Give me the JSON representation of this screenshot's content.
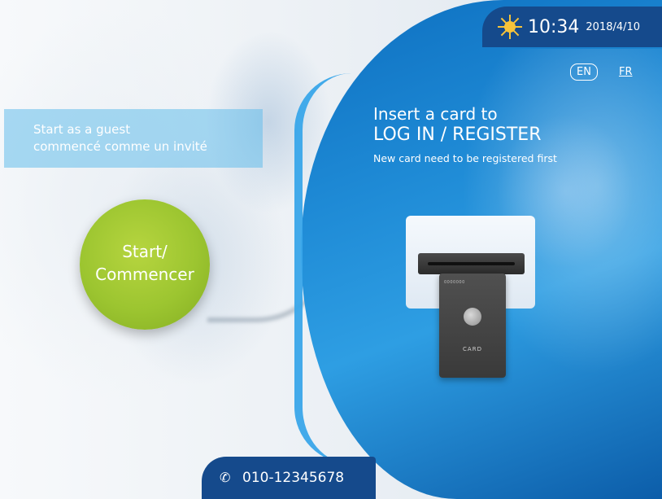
{
  "header": {
    "time": "10:34",
    "date": "2018/4/10",
    "weather_icon": "sun-icon"
  },
  "language": {
    "en_label": "EN",
    "fr_label": "FR"
  },
  "guest": {
    "line1": "Start as a guest",
    "line2": "commencé comme un invité"
  },
  "start_button": {
    "line1": "Start/",
    "line2": "Commencer"
  },
  "insert": {
    "title": "Insert a card to",
    "main": "LOG IN / REGISTER",
    "sub": "New card need to be registered first"
  },
  "card": {
    "dots": "0000000",
    "label": "CARD"
  },
  "footer": {
    "phone": "010-12345678",
    "phone_icon": "phone-icon"
  },
  "colors": {
    "accent_green": "#9cc530",
    "navy": "#154a8c",
    "blue": "#1f8bd6"
  }
}
